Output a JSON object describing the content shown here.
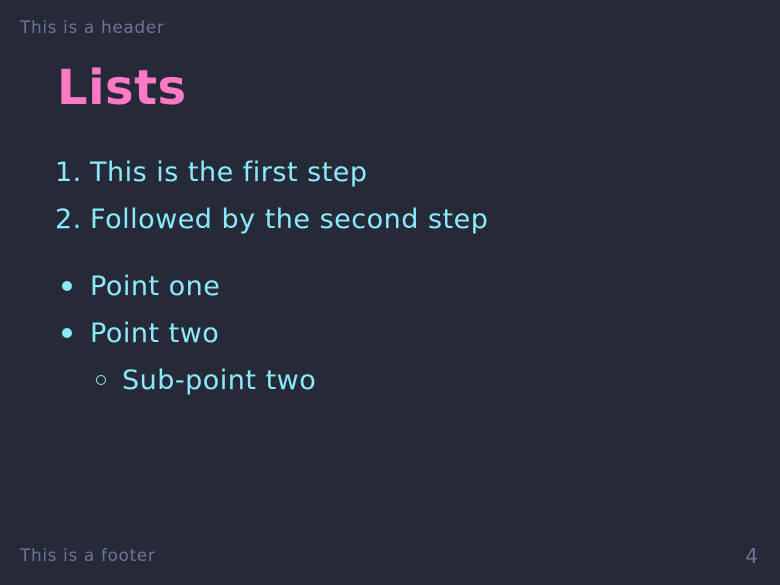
{
  "header": {
    "text": "This is a header"
  },
  "footer": {
    "text": "This is a footer"
  },
  "page_number": "4",
  "title": "Lists",
  "ordered_list": [
    {
      "number": "1.",
      "text": "This is the first step"
    },
    {
      "number": "2.",
      "text": "Followed by the second step"
    }
  ],
  "bullet_list": [
    {
      "text": "Point one"
    },
    {
      "text": "Point two"
    }
  ],
  "sub_bullet_list": [
    {
      "text": "Sub-point two"
    }
  ],
  "colors": {
    "background": "#252a36",
    "title": "#ff79c6",
    "list_text": "#8be9fd",
    "muted": "#6f7299"
  }
}
